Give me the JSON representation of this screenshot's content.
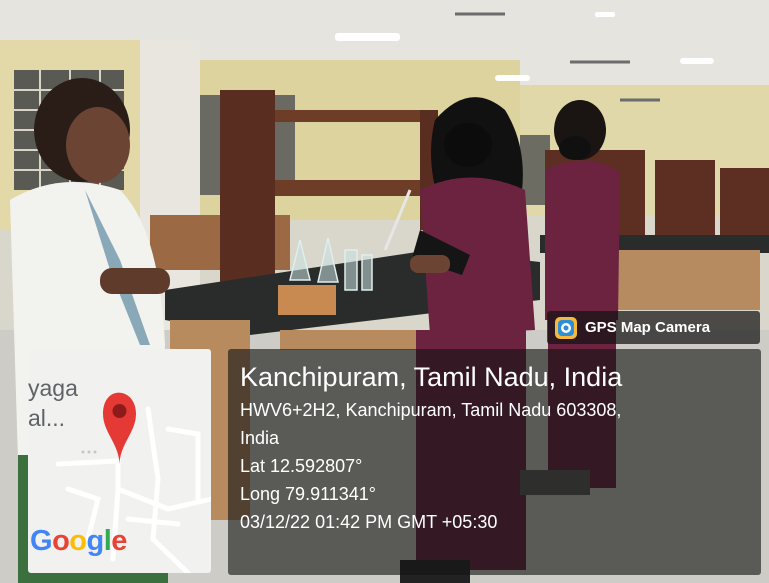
{
  "overlay": {
    "app_badge": "GPS Map Camera",
    "place_title": "Kanchipuram, Tamil Nadu, India",
    "address_line1": "HWV6+2H2, Kanchipuram, Tamil Nadu 603308,",
    "address_line2": "India",
    "latitude": "Lat 12.592807°",
    "longitude": "Long 79.911341°",
    "timestamp": "03/12/22 01:42 PM GMT +05:30"
  },
  "map": {
    "place_label": "yaga\nal...",
    "logo_letters": [
      "G",
      "o",
      "o",
      "g",
      "l",
      "e"
    ],
    "logo_colors": [
      "#4285F4",
      "#EA4335",
      "#FBBC05",
      "#4285F4",
      "#34A853",
      "#EA4335"
    ],
    "pin_color": "#E53935"
  },
  "colors": {
    "scrub_maroon": "#6b2340",
    "coat_white": "#f2f2ef",
    "bench_wood": "#6e3d28",
    "countertop": "#2a2c2c"
  },
  "icons": [
    "map-camera-icon",
    "location-pin-icon"
  ]
}
